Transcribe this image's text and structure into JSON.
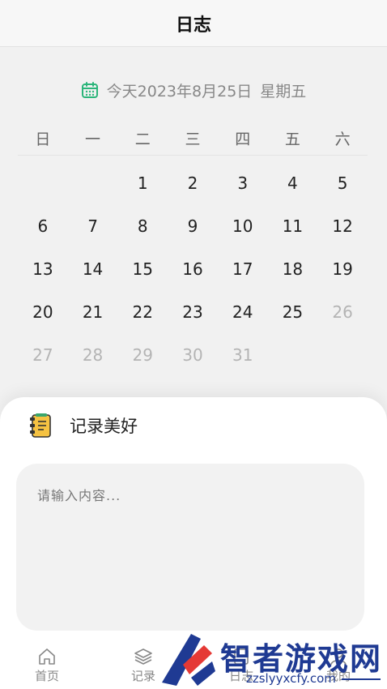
{
  "header": {
    "title": "日志"
  },
  "date_line": {
    "text": "今天2023年8月25日",
    "weekday": "星期五",
    "accent": "#2bb57a"
  },
  "calendar": {
    "weekdays": [
      "日",
      "一",
      "二",
      "三",
      "四",
      "五",
      "六"
    ],
    "leading_blanks": 2,
    "days": [
      {
        "label": "1",
        "muted": false
      },
      {
        "label": "2",
        "muted": false
      },
      {
        "label": "3",
        "muted": false
      },
      {
        "label": "4",
        "muted": false
      },
      {
        "label": "5",
        "muted": false
      },
      {
        "label": "6",
        "muted": false
      },
      {
        "label": "7",
        "muted": false
      },
      {
        "label": "8",
        "muted": false
      },
      {
        "label": "9",
        "muted": false
      },
      {
        "label": "10",
        "muted": false
      },
      {
        "label": "11",
        "muted": false
      },
      {
        "label": "12",
        "muted": false
      },
      {
        "label": "13",
        "muted": false
      },
      {
        "label": "14",
        "muted": false
      },
      {
        "label": "15",
        "muted": false
      },
      {
        "label": "16",
        "muted": false
      },
      {
        "label": "17",
        "muted": false
      },
      {
        "label": "18",
        "muted": false
      },
      {
        "label": "19",
        "muted": false
      },
      {
        "label": "20",
        "muted": false
      },
      {
        "label": "21",
        "muted": false
      },
      {
        "label": "22",
        "muted": false
      },
      {
        "label": "23",
        "muted": false
      },
      {
        "label": "24",
        "muted": false
      },
      {
        "label": "25",
        "muted": false
      },
      {
        "label": "26",
        "muted": true
      },
      {
        "label": "27",
        "muted": true
      },
      {
        "label": "28",
        "muted": true
      },
      {
        "label": "29",
        "muted": true
      },
      {
        "label": "30",
        "muted": true
      },
      {
        "label": "31",
        "muted": true
      }
    ]
  },
  "note_sheet": {
    "title": "记录美好",
    "icon": "notebook-icon",
    "placeholder": "请输入内容..."
  },
  "tabbar": {
    "tabs": [
      {
        "label": "首页",
        "icon": "home-icon"
      },
      {
        "label": "记录",
        "icon": "layers-icon"
      },
      {
        "label": "日志",
        "icon": "journal-icon"
      },
      {
        "label": "我的",
        "icon": "user-icon"
      }
    ]
  },
  "watermark": {
    "title": "智者游戏网",
    "url": "zzslyyxcfy.com"
  }
}
